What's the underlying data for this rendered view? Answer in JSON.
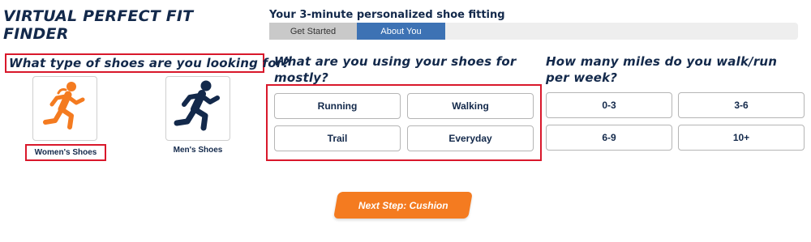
{
  "page": {
    "title": "VIRTUAL PERFECT FIT FINDER"
  },
  "progress": {
    "caption": "Your 3-minute personalized shoe fitting",
    "steps": [
      {
        "label": "Get Started",
        "state": "done"
      },
      {
        "label": "About You",
        "state": "active"
      }
    ]
  },
  "shoe_type": {
    "question": "What type of shoes are you looking for?",
    "options": [
      {
        "label": "Women's Shoes",
        "icon": "runner-icon",
        "color": "#f47b20",
        "selected": true
      },
      {
        "label": "Men's Shoes",
        "icon": "runner-icon",
        "color": "#13294b",
        "selected": false
      }
    ]
  },
  "usage": {
    "question": "What are you using your shoes for mostly?",
    "options": [
      "Running",
      "Walking",
      "Trail",
      "Everyday"
    ]
  },
  "miles": {
    "question": "How many miles do you walk/run per week?",
    "options": [
      "0-3",
      "3-6",
      "6-9",
      "10+"
    ]
  },
  "next_button": {
    "label": "Next Step: Cushion",
    "color": "#f47b20"
  },
  "colors": {
    "navy": "#13294b",
    "highlight_red": "#d9182b",
    "step_active": "#3d72b4",
    "step_done": "#c9c9c9"
  }
}
